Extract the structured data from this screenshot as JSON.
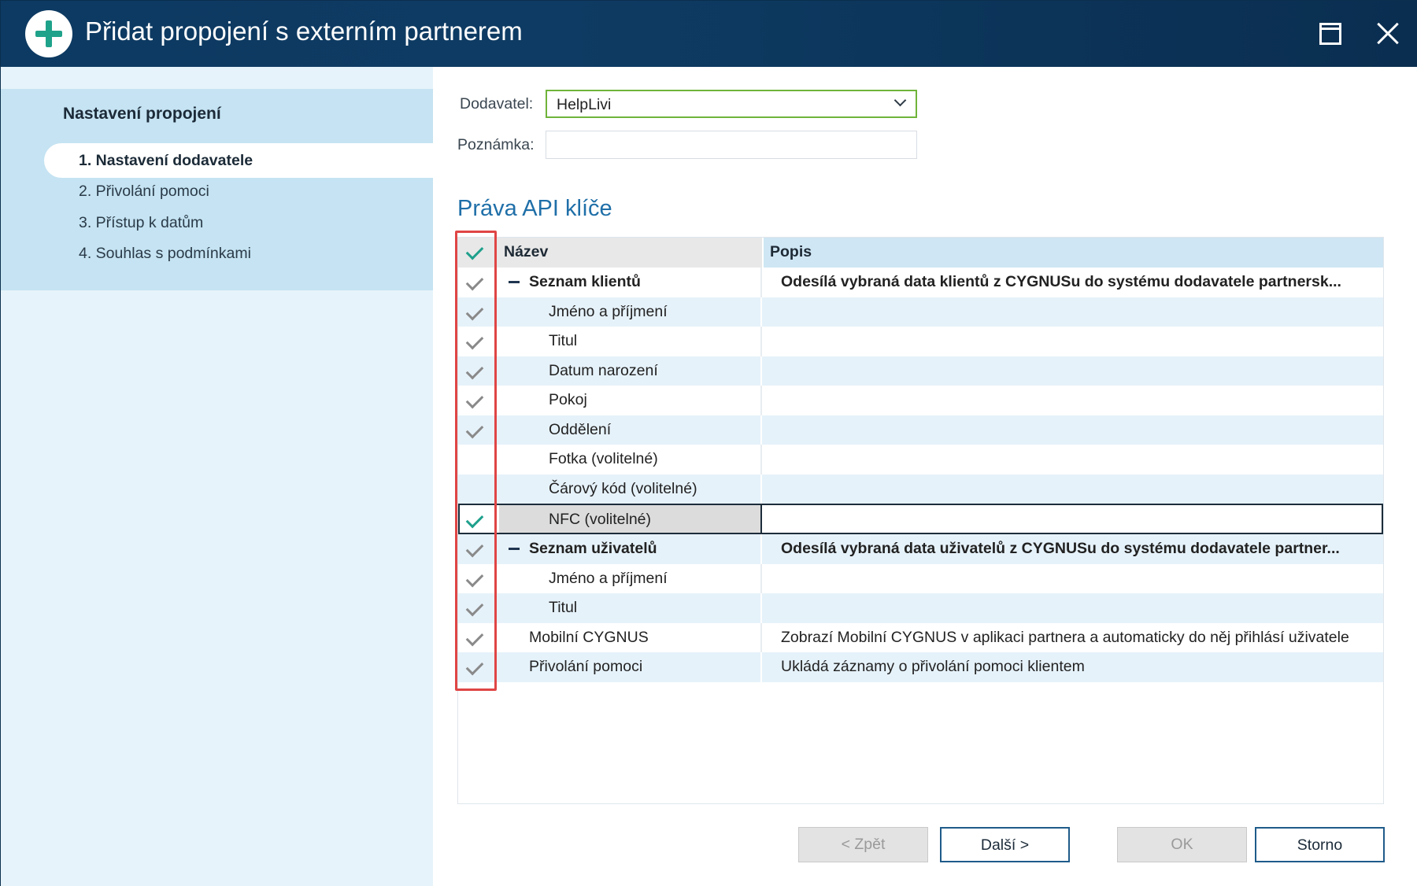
{
  "window": {
    "title": "Přidat propojení s externím partnerem"
  },
  "sidebar": {
    "title": "Nastavení propojení",
    "steps": [
      {
        "label": "1. Nastavení dodavatele",
        "active": true
      },
      {
        "label": "2. Přivolání pomoci",
        "active": false
      },
      {
        "label": "3. Přístup k datům",
        "active": false
      },
      {
        "label": "4. Souhlas s podmínkami",
        "active": false
      }
    ]
  },
  "form": {
    "supplier_label": "Dodavatel:",
    "supplier_value": "HelpLivi",
    "note_label": "Poznámka:",
    "note_value": ""
  },
  "api_rights": {
    "title": "Práva API klíče",
    "columns": {
      "name": "Název",
      "description": "Popis"
    },
    "rows": [
      {
        "name": "Seznam klientů",
        "description": "Odesílá vybraná data klientů z CYGNUSu do systému dodavatele partnersk...",
        "checked": true,
        "group": true,
        "level": 0
      },
      {
        "name": "Jméno a příjmení",
        "description": "",
        "checked": true,
        "level": 1
      },
      {
        "name": "Titul",
        "description": "",
        "checked": true,
        "level": 1
      },
      {
        "name": "Datum narození",
        "description": "",
        "checked": true,
        "level": 1
      },
      {
        "name": "Pokoj",
        "description": "",
        "checked": true,
        "level": 1
      },
      {
        "name": "Oddělení",
        "description": "",
        "checked": true,
        "level": 1
      },
      {
        "name": "Fotka (volitelné)",
        "description": "",
        "checked": false,
        "level": 1
      },
      {
        "name": "Čárový kód (volitelné)",
        "description": "",
        "checked": false,
        "level": 1
      },
      {
        "name": "NFC (volitelné)",
        "description": "",
        "checked": true,
        "level": 1,
        "selected": true
      },
      {
        "name": "Seznam uživatelů",
        "description": "Odesílá vybraná data uživatelů z CYGNUSu do systému dodavatele partner...",
        "checked": true,
        "group": true,
        "level": 0
      },
      {
        "name": "Jméno a příjmení",
        "description": "",
        "checked": true,
        "level": 1
      },
      {
        "name": "Titul",
        "description": "",
        "checked": true,
        "level": 1
      },
      {
        "name": "Mobilní CYGNUS",
        "description": "Zobrazí Mobilní CYGNUS v aplikaci partnera a automaticky do něj přihlásí uživatele",
        "checked": true,
        "level": 0
      },
      {
        "name": "Přivolání pomoci",
        "description": "Ukládá záznamy o přivolání pomoci klientem",
        "checked": true,
        "level": 0
      }
    ]
  },
  "buttons": {
    "back": "< Zpět",
    "next": "Další >",
    "ok": "OK",
    "cancel": "Storno"
  },
  "colors": {
    "titlebar": "#0d3a62",
    "accent_green": "#1ea08c",
    "highlight_red": "#e04545",
    "select_border": "#6fb43a"
  }
}
